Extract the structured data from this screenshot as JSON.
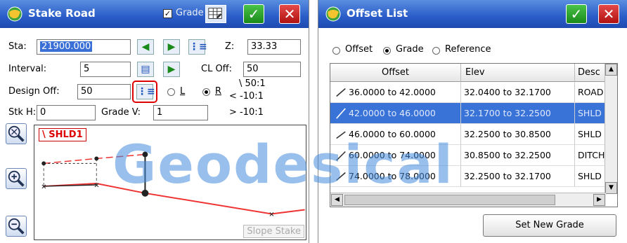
{
  "stake_road": {
    "title": "Stake Road",
    "grade_label": "Grade",
    "grade_checked": true,
    "sta_label": "Sta:",
    "sta_value": "21900.000",
    "z_label": "Z:",
    "z_value": "33.33",
    "interval_label": "Interval:",
    "interval_value": "5",
    "cl_off_label": "CL Off:",
    "cl_off_value": "50",
    "design_off_label": "Design Off:",
    "design_off_value": "50",
    "side_l": "L",
    "side_r": "R",
    "slope_lines": [
      "\\ 50:1",
      "< -10:1",
      "> -10:1"
    ],
    "stk_h_label": "Stk H:",
    "stk_h_value": "0",
    "grade_v_label": "Grade V:",
    "grade_v_value": "1",
    "shld_badge": "\\ SHLD1",
    "slope_stake_button": "Slope Stake"
  },
  "offset_list": {
    "title": "Offset List",
    "radio_offset": "Offset",
    "radio_grade": "Grade",
    "radio_reference": "Reference",
    "selected_radio": "Grade",
    "columns": [
      "Offset",
      "Elev",
      "Desc"
    ],
    "rows": [
      {
        "offset": "36.0000 to 42.0000",
        "elev": "32.0400 to 32.1700",
        "desc": "ROAD"
      },
      {
        "offset": "42.0000 to 46.0000",
        "elev": "32.1700 to 32.2500",
        "desc": "SHLD"
      },
      {
        "offset": "46.0000 to 60.0000",
        "elev": "32.2500 to 30.8500",
        "desc": "SHLD"
      },
      {
        "offset": "60.0000 to 74.0000",
        "elev": "30.8500 to 32.2500",
        "desc": "DITCH"
      },
      {
        "offset": "74.0000 to 78.0000",
        "elev": "32.2500 to 32.1700",
        "desc": "SHLD"
      }
    ],
    "selected_row": 1,
    "set_new_grade_button": "Set New Grade"
  },
  "watermark": "Geodesical",
  "colors": {
    "title_blue": "#2a5cc8",
    "ok_green": "#1a8a1a",
    "cancel_red": "#c01010",
    "highlight_red": "#d00000",
    "selection_blue": "#3a73d8"
  }
}
